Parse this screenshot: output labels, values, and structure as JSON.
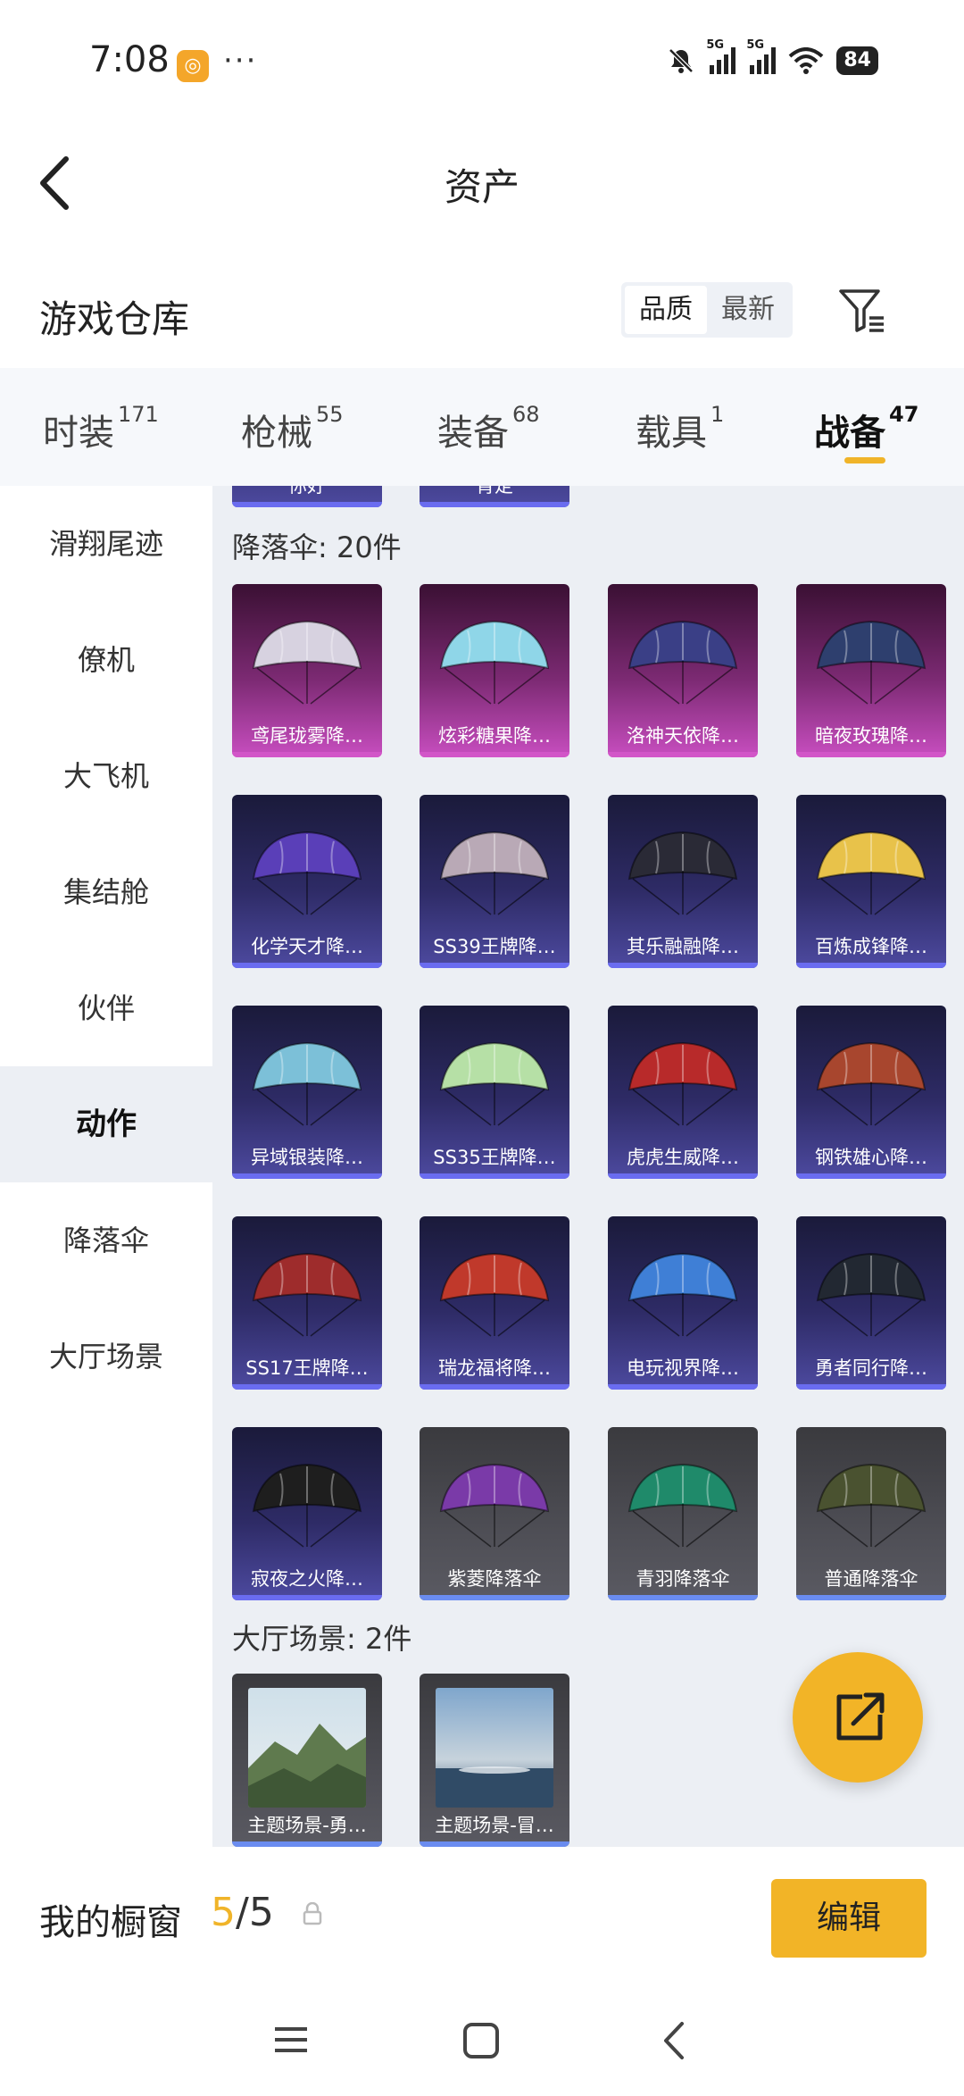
{
  "status_bar": {
    "time": "7:08",
    "more": "···",
    "network1": "5G",
    "network2": "5G",
    "battery": "84"
  },
  "header": {
    "title": "资产"
  },
  "warehouse": {
    "title": "游戏仓库",
    "sort_options": [
      "品质",
      "最新"
    ],
    "active_sort": "品质"
  },
  "tabs": [
    {
      "label": "时装",
      "count": "171"
    },
    {
      "label": "枪械",
      "count": "55"
    },
    {
      "label": "装备",
      "count": "68"
    },
    {
      "label": "载具",
      "count": "1"
    },
    {
      "label": "战备",
      "count": "47"
    }
  ],
  "active_tab": "战备",
  "sidebar": {
    "items": [
      "滑翔尾迹",
      "僚机",
      "大飞机",
      "集结舱",
      "伙伴",
      "动作",
      "降落伞",
      "大厅场景"
    ],
    "active": "动作"
  },
  "content": {
    "top_partial_labels": [
      "你好",
      "肯定"
    ],
    "sections": [
      {
        "title": "降落伞: 20件",
        "items": [
          {
            "name": "鸢尾珑雾降…",
            "tier": "purple",
            "color": "#d7d2e0"
          },
          {
            "name": "炫彩糖果降…",
            "tier": "purple",
            "color": "#8fd6e8"
          },
          {
            "name": "洛神天依降…",
            "tier": "purple",
            "color": "#3a3f86"
          },
          {
            "name": "暗夜玫瑰降…",
            "tier": "purple",
            "color": "#2e3f6e"
          },
          {
            "name": "化学天才降…",
            "tier": "blue",
            "color": "#5a3fb8"
          },
          {
            "name": "SS39王牌降…",
            "tier": "blue",
            "color": "#b9a9b6"
          },
          {
            "name": "其乐融融降…",
            "tier": "blue",
            "color": "#2a2a36"
          },
          {
            "name": "百炼成锋降…",
            "tier": "blue",
            "color": "#e8c24a"
          },
          {
            "name": "异域银装降…",
            "tier": "blue",
            "color": "#7cc0d8"
          },
          {
            "name": "SS35王牌降…",
            "tier": "blue",
            "color": "#b6e0a6"
          },
          {
            "name": "虎虎生威降…",
            "tier": "blue",
            "color": "#b82a2a"
          },
          {
            "name": "钢铁雄心降…",
            "tier": "blue",
            "color": "#a8462e"
          },
          {
            "name": "SS17王牌降…",
            "tier": "blue",
            "color": "#9e2c2c"
          },
          {
            "name": "瑞龙福将降…",
            "tier": "blue",
            "color": "#c0392b"
          },
          {
            "name": "电玩视界降…",
            "tier": "blue",
            "color": "#3f7fd6"
          },
          {
            "name": "勇者同行降…",
            "tier": "blue",
            "color": "#222832"
          },
          {
            "name": "寂夜之火降…",
            "tier": "blue",
            "color": "#1e1e1e"
          },
          {
            "name": "紫菱降落伞",
            "tier": "gray",
            "color": "#7a3aa8"
          },
          {
            "name": "青羽降落伞",
            "tier": "gray",
            "color": "#1f8a6a"
          },
          {
            "name": "普通降落伞",
            "tier": "gray",
            "color": "#4a5230"
          }
        ]
      },
      {
        "title": "大厅场景: 2件",
        "items": [
          {
            "name": "主题场景-勇…",
            "tier": "gray"
          },
          {
            "name": "主题场景-冒…",
            "tier": "gray"
          }
        ]
      }
    ]
  },
  "bottom_bar": {
    "label": "我的橱窗",
    "current": "5",
    "separator": "/",
    "total": "5",
    "edit_label": "编辑"
  },
  "colors": {
    "accent": "#f2b427",
    "active_underline": "#f0b429",
    "content_bg": "#eceff4"
  }
}
